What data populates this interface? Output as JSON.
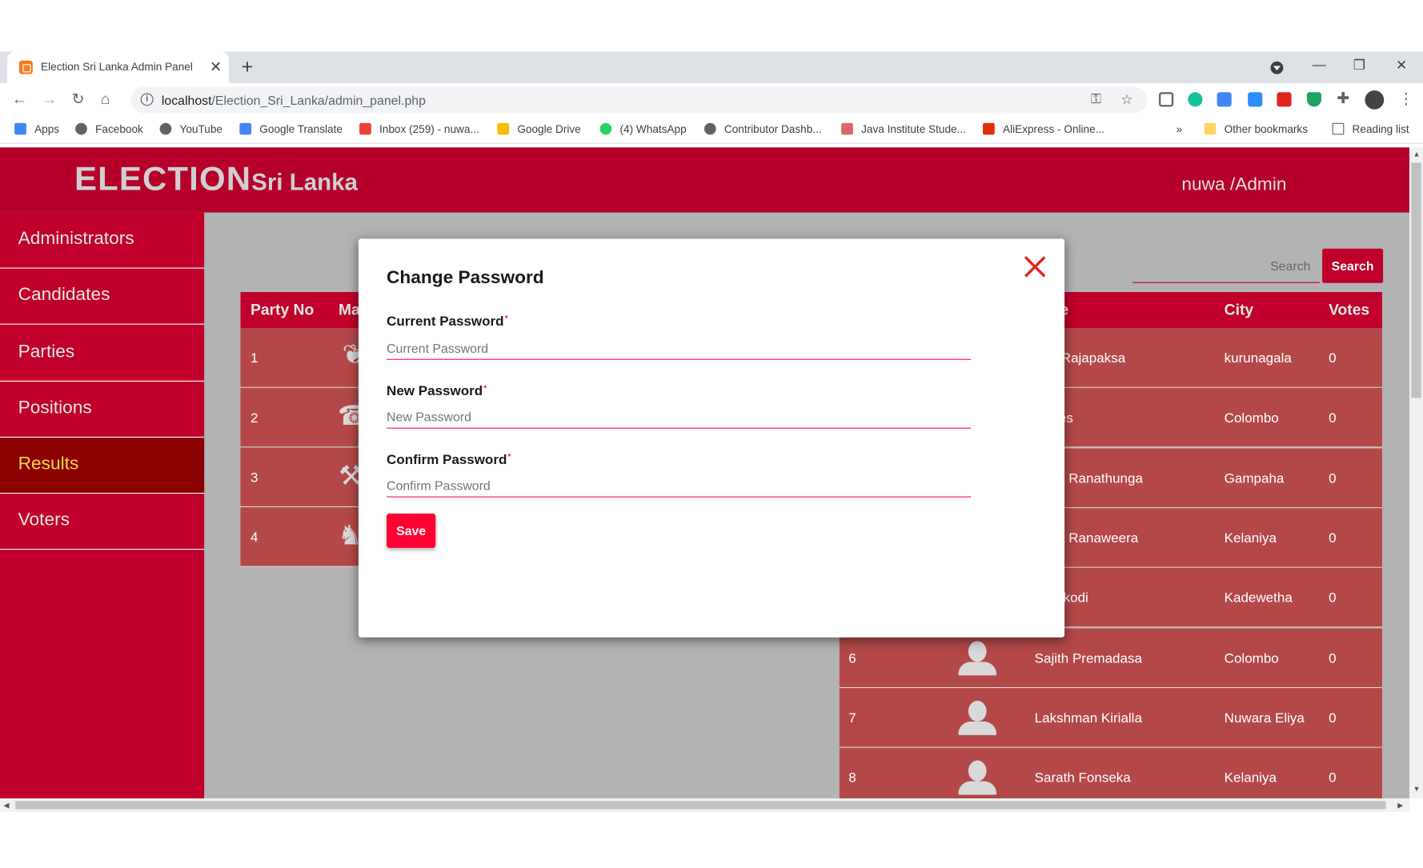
{
  "browser": {
    "tab_title": "Election Sri Lanka Admin Panel",
    "url_host": "localhost",
    "url_path": "/Election_Sri_Lanka/admin_panel.php",
    "bookmarks": [
      "Apps",
      "Facebook",
      "YouTube",
      "Google Translate",
      "Inbox (259) - nuwa...",
      "Google Drive",
      "(4) WhatsApp",
      "Contributor Dashb...",
      "Java Institute Stude...",
      "AliExpress - Online..."
    ],
    "other_bookmarks": "Other bookmarks",
    "reading_list": "Reading list",
    "overflow": "»"
  },
  "header": {
    "logo_big": "ELECTION",
    "logo_small": "Sri Lanka",
    "user": "nuwa /Admin"
  },
  "sidebar": {
    "items": [
      {
        "label": "Administrators"
      },
      {
        "label": "Candidates"
      },
      {
        "label": "Parties"
      },
      {
        "label": "Positions"
      },
      {
        "label": "Results"
      },
      {
        "label": "Voters"
      }
    ],
    "active": "Results"
  },
  "search": {
    "placeholder": "Search",
    "button_label": "Search"
  },
  "party_table": {
    "headers": [
      "Party No",
      "Ma"
    ],
    "rows": [
      {
        "no": "1"
      },
      {
        "no": "2"
      },
      {
        "no": "3"
      },
      {
        "no": "4"
      }
    ]
  },
  "candidate_table": {
    "headers": [
      "e",
      "City",
      "Votes"
    ],
    "rows": [
      {
        "no": "",
        "name": "nda Rajapaksa",
        "city": "kurunagala",
        "votes": "0"
      },
      {
        "no": "",
        "name": "Peries",
        "city": "Colombo",
        "votes": "0"
      },
      {
        "no": "",
        "name": "anna Ranathunga",
        "city": "Gampaha",
        "votes": "0"
      },
      {
        "no": "",
        "name": "anna Ranaweera",
        "city": "Kelaniya",
        "votes": "0"
      },
      {
        "no": "",
        "name": "Jayakodi",
        "city": "Kadewetha",
        "votes": "0"
      },
      {
        "no": "6",
        "name": "Sajith Premadasa",
        "city": "Colombo",
        "votes": "0"
      },
      {
        "no": "7",
        "name": "Lakshman Kirialla",
        "city": "Nuwara Eliya",
        "votes": "0"
      },
      {
        "no": "8",
        "name": "Sarath Fonseka",
        "city": "Kelaniya",
        "votes": "0"
      }
    ]
  },
  "modal": {
    "title": "Change Password",
    "required_mark": "*",
    "fields": [
      {
        "label": "Current Password",
        "placeholder": "Current Password",
        "value": ""
      },
      {
        "label": "New Password",
        "placeholder": "New Password",
        "value": ""
      },
      {
        "label": "Confirm Password",
        "placeholder": "Confirm Password",
        "value": ""
      }
    ],
    "save_label": "Save"
  },
  "colors": {
    "header": "#b5002a",
    "sidebar": "#c0002a",
    "active_item": "#8b0000",
    "active_text": "#f2d64a",
    "row": "#b44848",
    "save": "#ff0033",
    "close": "#e2231a"
  },
  "icons": [
    "info-icon",
    "key-icon",
    "star-icon",
    "close-icon",
    "avatar-icon",
    "party-symbol-icon",
    "folder-icon",
    "reading-list-icon"
  ]
}
